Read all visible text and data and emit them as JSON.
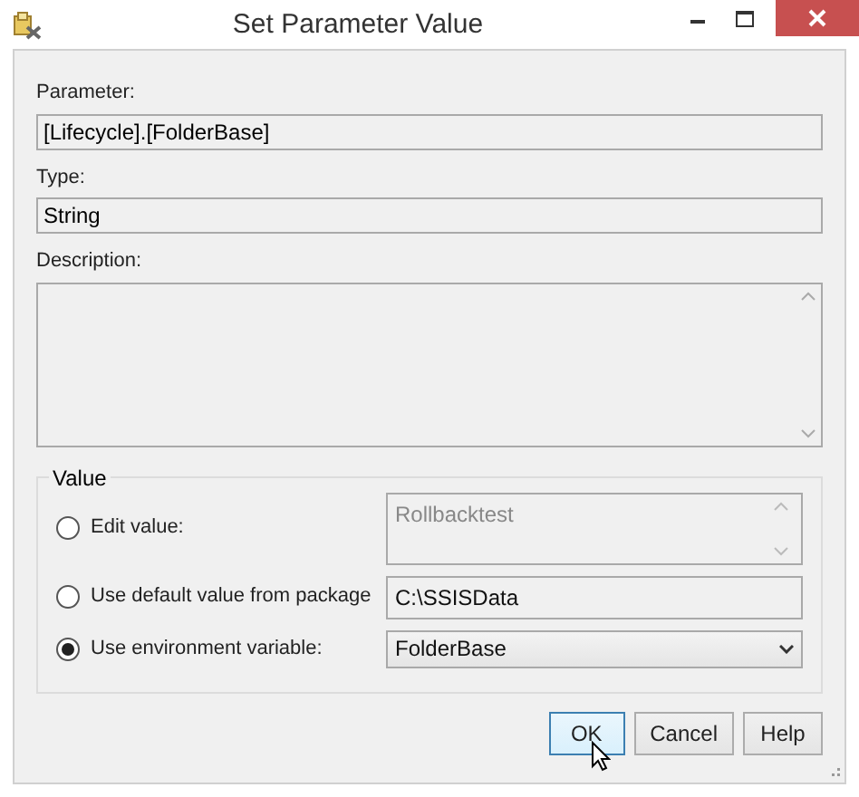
{
  "window": {
    "title": "Set Parameter Value"
  },
  "fields": [
    {
      "label": "Parameter:",
      "value": "[Lifecycle].[FolderBase]"
    },
    {
      "label": "Type:",
      "value": "String"
    }
  ],
  "description": {
    "label": "Description:"
  },
  "value_group": {
    "title": "Value",
    "options": [
      {
        "label": "Edit value:",
        "selected": false,
        "kind": "textarea",
        "value": "Rollbacktest",
        "disabled": true
      },
      {
        "label": "Use default value from package",
        "selected": false,
        "kind": "text",
        "value": "C:\\SSISData"
      },
      {
        "label": "Use environment variable:",
        "selected": true,
        "kind": "select",
        "value": "FolderBase"
      }
    ]
  },
  "buttons": [
    {
      "label": "OK",
      "default": true
    },
    {
      "label": "Cancel",
      "default": false
    },
    {
      "label": "Help",
      "default": false
    }
  ]
}
